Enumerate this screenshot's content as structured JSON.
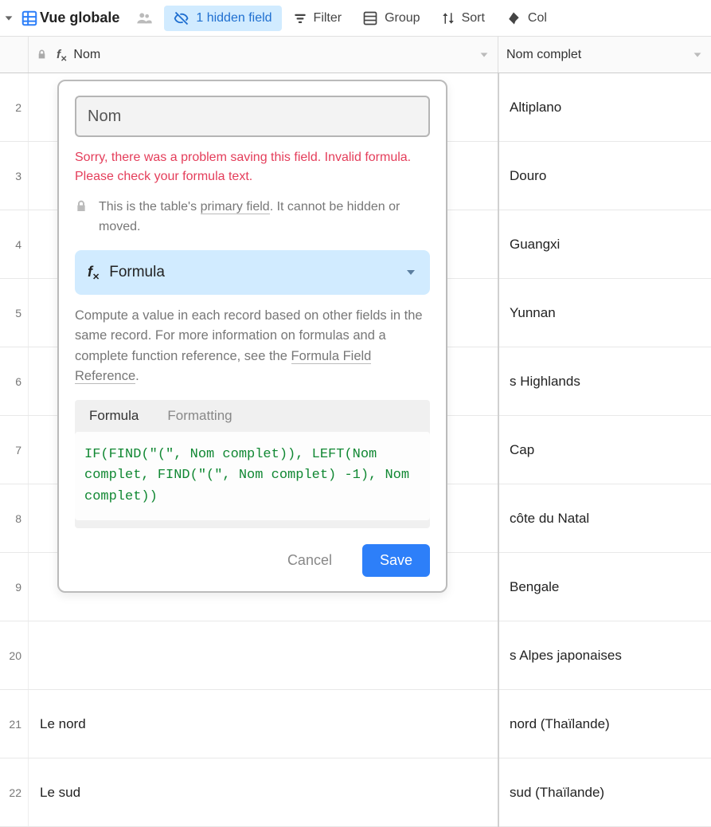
{
  "toolbar": {
    "view_name": "Vue globale",
    "hidden_field": "1 hidden field",
    "filter": "Filter",
    "group": "Group",
    "sort": "Sort",
    "color": "Col"
  },
  "columns": {
    "nom": "Nom",
    "nom_complet": "Nom complet"
  },
  "rows": [
    {
      "num": "2",
      "nom": "",
      "nomc": "Altiplano"
    },
    {
      "num": "3",
      "nom": "",
      "nomc": "Douro"
    },
    {
      "num": "4",
      "nom": "",
      "nomc": "Guangxi"
    },
    {
      "num": "5",
      "nom": "",
      "nomc": "Yunnan"
    },
    {
      "num": "6",
      "nom": "",
      "nomc": "s Highlands"
    },
    {
      "num": "7",
      "nom": "",
      "nomc": "Cap"
    },
    {
      "num": "8",
      "nom": "",
      "nomc": "côte du Natal"
    },
    {
      "num": "9",
      "nom": "",
      "nomc": "Bengale"
    },
    {
      "num": "20",
      "nom": "",
      "nomc": "s Alpes japonaises"
    },
    {
      "num": "21",
      "nom": "Le nord",
      "nomc": "nord (Thaïlande)"
    },
    {
      "num": "22",
      "nom": "Le sud",
      "nomc": "sud (Thaïlande)"
    }
  ],
  "popover": {
    "field_name": "Nom",
    "error": "Sorry, there was a problem saving this field. Invalid formula. Please check your formula text.",
    "primary_pre": "This is the table's ",
    "primary_link": "primary field",
    "primary_post": ". It cannot be hidden or moved.",
    "type_label": "Formula",
    "type_desc_pre": "Compute a value in each record based on other fields in the same record. For more information on formulas and a complete function reference, see the ",
    "type_desc_link": "Formula Field Reference",
    "type_desc_post": ".",
    "tabs": {
      "formula": "Formula",
      "formatting": "Formatting"
    },
    "formula_text": "IF(FIND(\"(\", Nom complet)), LEFT(Nom complet, FIND(\"(\", Nom complet) -1), Nom complet))",
    "cancel": "Cancel",
    "save": "Save"
  }
}
